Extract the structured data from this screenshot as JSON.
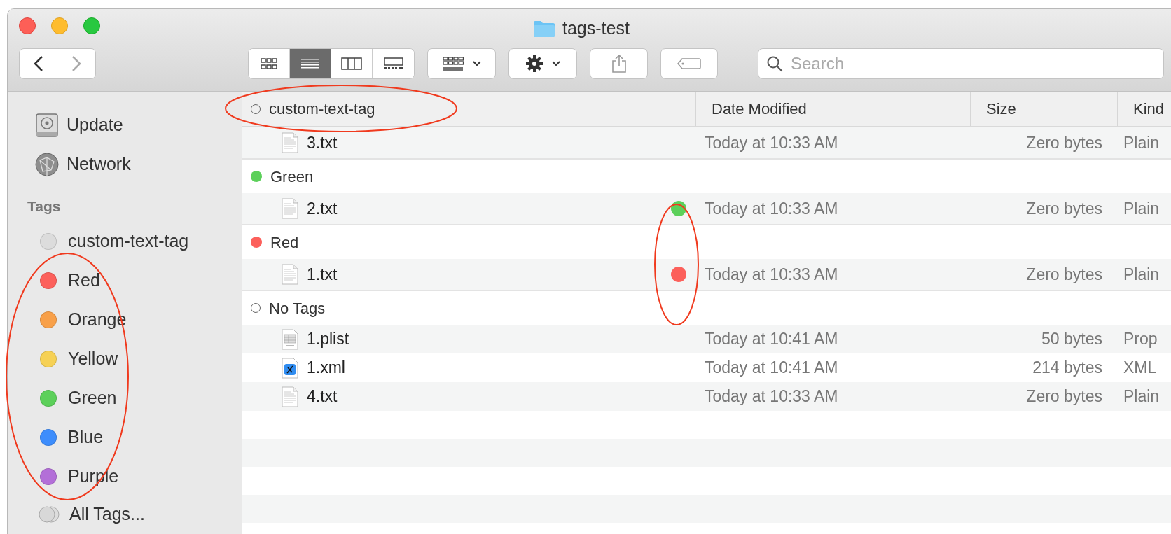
{
  "window": {
    "title": "tags-test"
  },
  "toolbar": {
    "views": [
      {
        "kind": "icons",
        "selected": false
      },
      {
        "kind": "list",
        "selected": true
      },
      {
        "kind": "columns",
        "selected": false
      },
      {
        "kind": "gallery",
        "selected": false
      }
    ],
    "search": {
      "placeholder": "Search"
    }
  },
  "sidebar": {
    "locations": [
      {
        "label": "Update",
        "kind": "disk"
      },
      {
        "label": "Network",
        "kind": "network"
      }
    ],
    "tags_heading": "Tags",
    "tags": [
      {
        "label": "custom-text-tag",
        "color": "#dcdcdc"
      },
      {
        "label": "Red",
        "color": "#fc605b"
      },
      {
        "label": "Orange",
        "color": "#f8a049"
      },
      {
        "label": "Yellow",
        "color": "#f6d155"
      },
      {
        "label": "Green",
        "color": "#5cd05a"
      },
      {
        "label": "Blue",
        "color": "#3d8dfc"
      },
      {
        "label": "Purple",
        "color": "#b36fd8"
      }
    ],
    "all_tags": "All Tags..."
  },
  "table": {
    "columns": [
      "Date Modified",
      "Size",
      "Kind"
    ],
    "groups": [
      {
        "label": "custom-text-tag",
        "kind": "hollow",
        "files": [
          {
            "name": "3.txt",
            "kind": "text",
            "date": "Today at 10:33 AM",
            "size": "Zero bytes",
            "kind_cell": "Plain"
          }
        ]
      },
      {
        "label": "Green",
        "kind": "dot",
        "color": "#5cd05a",
        "files": [
          {
            "name": "2.txt",
            "kind": "text",
            "color": "#5cd05a",
            "date": "Today at 10:33 AM",
            "size": "Zero bytes",
            "kind_cell": "Plain"
          }
        ]
      },
      {
        "label": "Red",
        "kind": "dot",
        "color": "#fc605b",
        "files": [
          {
            "name": "1.txt",
            "kind": "text",
            "color": "#fc605b",
            "date": "Today at 10:33 AM",
            "size": "Zero bytes",
            "kind_cell": "Plain"
          }
        ]
      },
      {
        "label": "No Tags",
        "kind": "hollow",
        "files": [
          {
            "name": "1.plist",
            "kind": "plist",
            "date": "Today at 10:41 AM",
            "size": "50 bytes",
            "kind_cell": "Prop"
          },
          {
            "name": "1.xml",
            "kind": "xml",
            "date": "Today at 10:41 AM",
            "size": "214 bytes",
            "kind_cell": "XML"
          },
          {
            "name": "4.txt",
            "kind": "text",
            "date": "Today at 10:33 AM",
            "size": "Zero bytes",
            "kind_cell": "Plain"
          }
        ]
      }
    ]
  },
  "annotations": [
    {
      "kind": "ellipse",
      "color": "#f03a1e"
    },
    {
      "kind": "ellipse",
      "color": "#f03a1e"
    },
    {
      "kind": "ellipse",
      "color": "#f03a1e"
    }
  ]
}
